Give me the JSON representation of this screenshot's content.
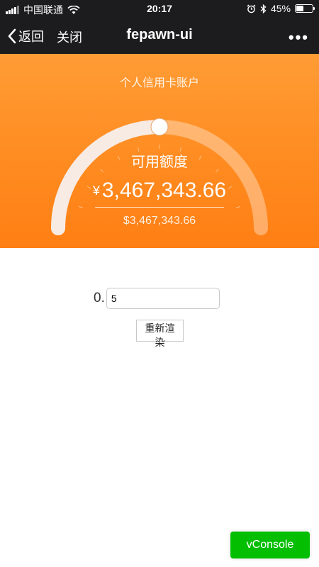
{
  "status_bar": {
    "carrier": "中国联通",
    "time": "20:17",
    "battery_text": "45%",
    "battery_level": 0.45,
    "icons": [
      "signal-icon",
      "wifi-icon",
      "alarm-icon",
      "bluetooth-icon",
      "battery-icon"
    ]
  },
  "nav": {
    "back_label": "返回",
    "close_label": "关闭",
    "title": "fepawn-ui",
    "more_label": "•••"
  },
  "account": {
    "title": "个人信用卡账户",
    "label": "可用额度",
    "currency_symbol": "¥",
    "amount": "3,467,343.66",
    "usd_amount": "$3,467,343.66",
    "gauge_level": 0.5,
    "colors": {
      "primary": "#ff8a1f",
      "track": "rgba(255,255,255,0.35)",
      "progress": "#f7e9df"
    }
  },
  "form": {
    "prefix": "0.",
    "input_value": "5",
    "rerender_label": "重新渲染"
  },
  "vconsole": {
    "label": "vConsole",
    "color": "#04be02"
  }
}
